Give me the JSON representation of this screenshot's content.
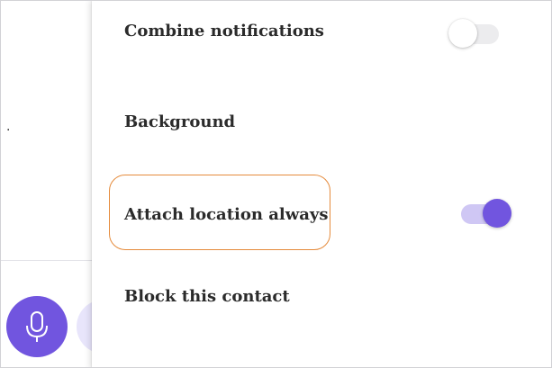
{
  "background_screen": {
    "dot_text": ".",
    "mic_icon": "microphone-icon",
    "accent_color": "#7155df",
    "secondary_color": "#e8e5fb"
  },
  "settings": {
    "items": [
      {
        "label": "Combine notifications",
        "toggle": "off"
      },
      {
        "label": "Background"
      },
      {
        "label": "Attach location always",
        "toggle": "on",
        "highlighted": true,
        "highlight_color": "#e58b3c"
      },
      {
        "label": "Block this contact"
      }
    ]
  }
}
